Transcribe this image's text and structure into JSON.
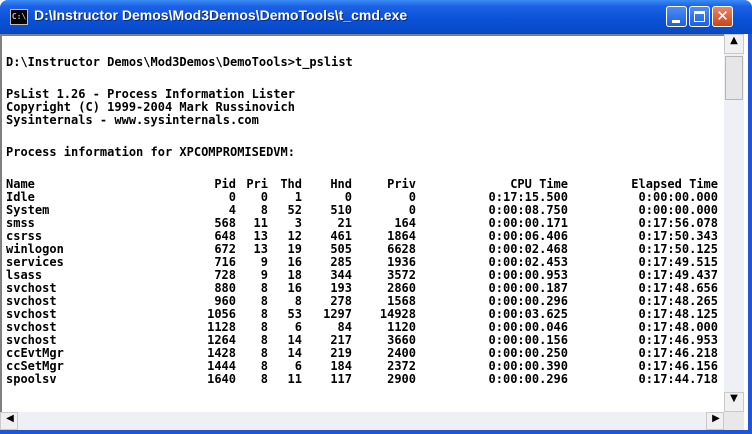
{
  "window": {
    "title": "D:\\Instructor Demos\\Mod3Demos\\DemoTools\\t_cmd.exe"
  },
  "titlebar_icon": {
    "name": "console-icon",
    "glyph": "C:\\"
  },
  "buttons": {
    "minimize": "minimize-icon",
    "maximize": "maximize-icon",
    "close_glyph": "✕"
  },
  "console": {
    "prompt": "D:\\Instructor Demos\\Mod3Demos\\DemoTools>t_pslist",
    "banner": [
      "PsList 1.26 - Process Information Lister",
      "Copyright (C) 1999-2004 Mark Russinovich",
      "Sysinternals - www.sysinternals.com"
    ],
    "info": "Process information for XPCOMPROMISEDVM:",
    "headers": [
      "Name",
      "Pid",
      "Pri",
      "Thd",
      "Hnd",
      "Priv",
      "CPU Time",
      "Elapsed Time"
    ],
    "rows": [
      [
        "Idle",
        "0",
        "0",
        "1",
        "0",
        "0",
        "0:17:15.500",
        "0:00:00.000"
      ],
      [
        "System",
        "4",
        "8",
        "52",
        "510",
        "0",
        "0:00:08.750",
        "0:00:00.000"
      ],
      [
        "smss",
        "568",
        "11",
        "3",
        "21",
        "164",
        "0:00:00.171",
        "0:17:56.078"
      ],
      [
        "csrss",
        "648",
        "13",
        "12",
        "461",
        "1864",
        "0:00:06.406",
        "0:17:50.343"
      ],
      [
        "winlogon",
        "672",
        "13",
        "19",
        "505",
        "6628",
        "0:00:02.468",
        "0:17:50.125"
      ],
      [
        "services",
        "716",
        "9",
        "16",
        "285",
        "1936",
        "0:00:02.453",
        "0:17:49.515"
      ],
      [
        "lsass",
        "728",
        "9",
        "18",
        "344",
        "3572",
        "0:00:00.953",
        "0:17:49.437"
      ],
      [
        "svchost",
        "880",
        "8",
        "16",
        "193",
        "2860",
        "0:00:00.187",
        "0:17:48.656"
      ],
      [
        "svchost",
        "960",
        "8",
        "8",
        "278",
        "1568",
        "0:00:00.296",
        "0:17:48.265"
      ],
      [
        "svchost",
        "1056",
        "8",
        "53",
        "1297",
        "14928",
        "0:00:03.625",
        "0:17:48.125"
      ],
      [
        "svchost",
        "1128",
        "8",
        "6",
        "84",
        "1120",
        "0:00:00.046",
        "0:17:48.000"
      ],
      [
        "svchost",
        "1264",
        "8",
        "14",
        "217",
        "3660",
        "0:00:00.156",
        "0:17:46.953"
      ],
      [
        "ccEvtMgr",
        "1428",
        "8",
        "14",
        "219",
        "2400",
        "0:00:00.250",
        "0:17:46.218"
      ],
      [
        "ccSetMgr",
        "1444",
        "8",
        "6",
        "184",
        "2372",
        "0:00:00.390",
        "0:17:46.156"
      ],
      [
        "spoolsv",
        "1640",
        "8",
        "11",
        "117",
        "2900",
        "0:00:00.296",
        "0:17:44.718"
      ]
    ]
  },
  "scrollbar": {
    "up": "▲",
    "down": "▼",
    "left": "◀",
    "right": "▶"
  }
}
